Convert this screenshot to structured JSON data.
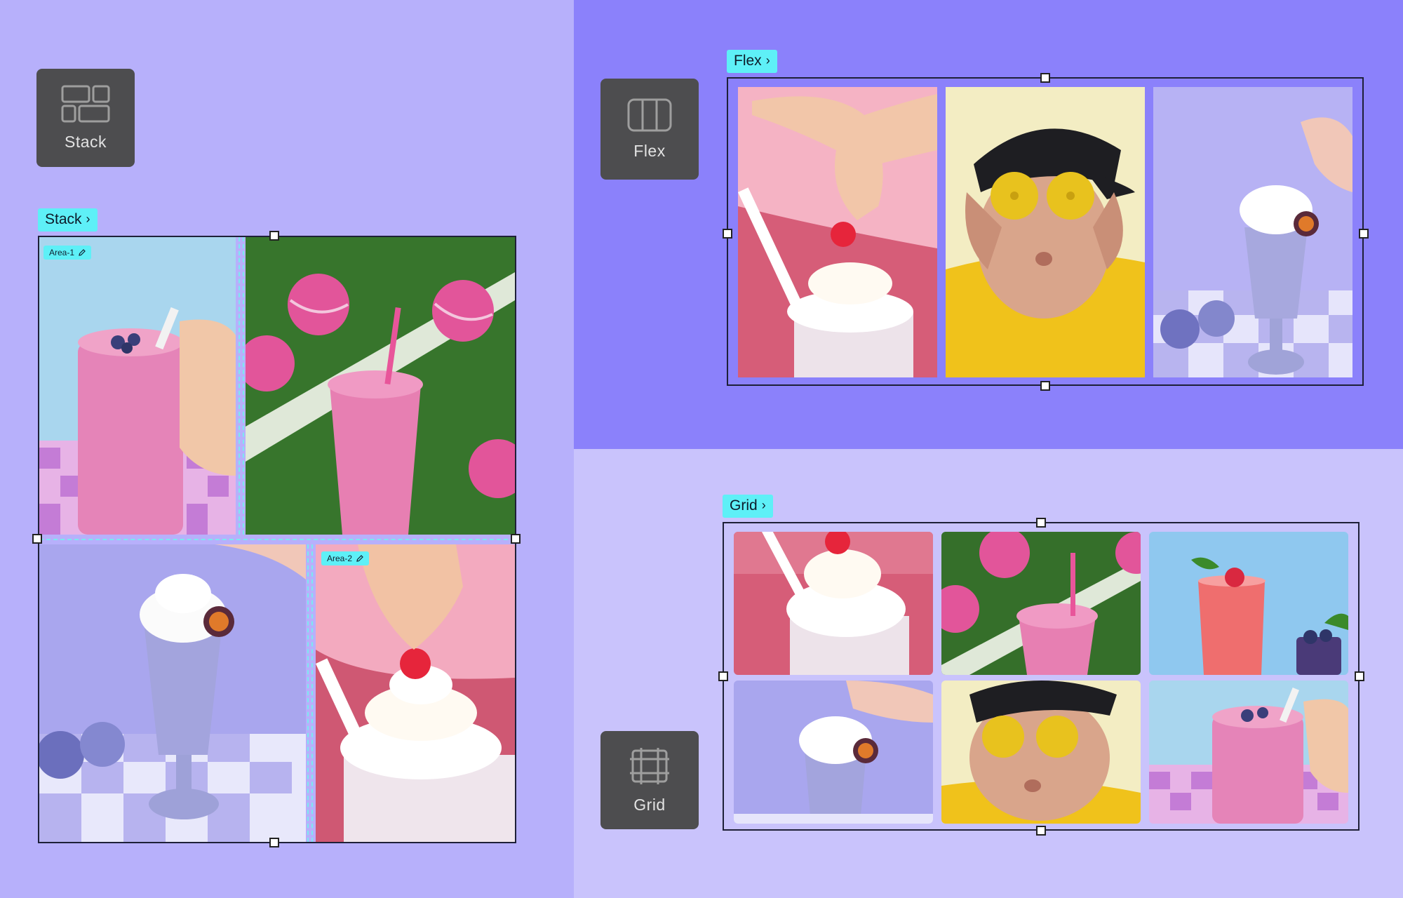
{
  "tools": {
    "stack_label": "Stack",
    "flex_label": "Flex",
    "grid_label": "Grid"
  },
  "tags": {
    "stack": "Stack",
    "flex": "Flex",
    "grid": "Grid",
    "chevron": "›"
  },
  "areas": {
    "area1": "Area-1",
    "area2": "Area-2"
  },
  "colors": {
    "left_bg": "#b7b0fb",
    "top_right_bg": "#8b81fb",
    "bottom_right_bg": "#c9c3fc",
    "tag_bg": "#5ef0f7",
    "tool_bg": "#4d4d4f"
  },
  "icons": {
    "stack": "stack-layout-icon",
    "flex": "flex-columns-icon",
    "grid": "grid-hash-icon",
    "edit": "pencil-icon"
  }
}
